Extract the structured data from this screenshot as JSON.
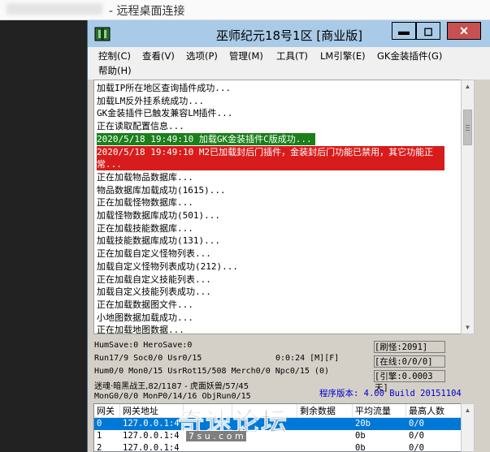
{
  "rdp": {
    "title": "- 远程桌面连接"
  },
  "window": {
    "title": "巫师纪元18号1区 [商业版]",
    "min_glyph": "▬",
    "max_glyph": "◻",
    "close_glyph": "✕"
  },
  "menu": [
    {
      "label": "控制(C)"
    },
    {
      "label": "查看(V)"
    },
    {
      "label": "选项(P)"
    },
    {
      "label": "管理(M)"
    },
    {
      "label": "工具(T)"
    },
    {
      "label": "LM引擎(E)"
    },
    {
      "label": "GK金装插件(G)"
    },
    {
      "label": "帮助(H)"
    }
  ],
  "log": [
    {
      "text": "加载IP所在地区查询插件成功...",
      "style": "normal"
    },
    {
      "text": "加载LM反外挂系统成功...",
      "style": "normal"
    },
    {
      "text": "GK金装插件已触发兼容LM插件...",
      "style": "normal"
    },
    {
      "text": "正在读取配置信息...",
      "style": "normal"
    },
    {
      "text": "2020/5/18 19:49:10 加载GK金装插件C版成功...",
      "style": "green"
    },
    {
      "text": "2020/5/18 19:49:10 M2已加载封后门插件，金装封后门功能已禁用，其它功能正",
      "style": "red"
    },
    {
      "text": "常...",
      "style": "red"
    },
    {
      "text": "正在加载物品数据库...",
      "style": "normal"
    },
    {
      "text": "物品数据库加载成功(1615)...",
      "style": "normal"
    },
    {
      "text": "正在加载怪物数据库...",
      "style": "normal"
    },
    {
      "text": "加载怪物数据库成功(501)...",
      "style": "normal"
    },
    {
      "text": "正在加载技能数据库...",
      "style": "normal"
    },
    {
      "text": "加载技能数据库成功(131)...",
      "style": "normal"
    },
    {
      "text": "正在加载自定义怪物列表...",
      "style": "normal"
    },
    {
      "text": "加载自定义怪物列表成功(212)...",
      "style": "normal"
    },
    {
      "text": "正在加载自定义技能列表...",
      "style": "normal"
    },
    {
      "text": "加载自定义技能列表成功...",
      "style": "normal"
    },
    {
      "text": "正在加载数据图文件...",
      "style": "normal"
    },
    {
      "text": "小地图数据加载成功...",
      "style": "normal"
    },
    {
      "text": "正在加载地图数据...",
      "style": "normal"
    }
  ],
  "status": {
    "line1": "HumSave:0 HeroSave:0",
    "line2a": "Run17/9 Soc0/0 Usr0/15",
    "line2b": "0:0:24 [M][F]",
    "line3": "Hum0/0 Mon0/15 UsrRot15/508 Merch0/0 Npc0/15 (0)",
    "line4": "迷魂·暗黑战王,82/1187 - 虎面妖兽/57/45",
    "line5": "MonG0/0/0 MonP0/14/16 ObjRun0/15",
    "box1": "[刷怪:2091]",
    "box2": "[在线:0/0/0]",
    "box3": "[引擎:0.0003天]",
    "version": "程序版本: 4.00 Build 20151104"
  },
  "gateway": {
    "headers": [
      "网关",
      "网关地址",
      "",
      "",
      "剩余数据",
      "平均流量",
      "最高人数"
    ],
    "rows": [
      {
        "cells": [
          "0",
          "127.0.0.1:4",
          "",
          "",
          "",
          "20b",
          "0/0"
        ],
        "selected": true
      },
      {
        "cells": [
          "1",
          "127.0.0.1:4",
          "",
          "",
          "",
          "0b",
          "0/0"
        ],
        "selected": false
      },
      {
        "cells": [
          "2",
          "127.0.0.1:4",
          "",
          "",
          "",
          "0b",
          "0/0"
        ],
        "selected": false
      }
    ]
  },
  "watermark": {
    "text": "奇速论坛",
    "sub": "7 s u . c o m"
  },
  "colors": {
    "titlebar": "#a9cbe8",
    "log_green": "#1a7f1a",
    "log_red": "#d81c1c",
    "selection": "#0078d7"
  }
}
